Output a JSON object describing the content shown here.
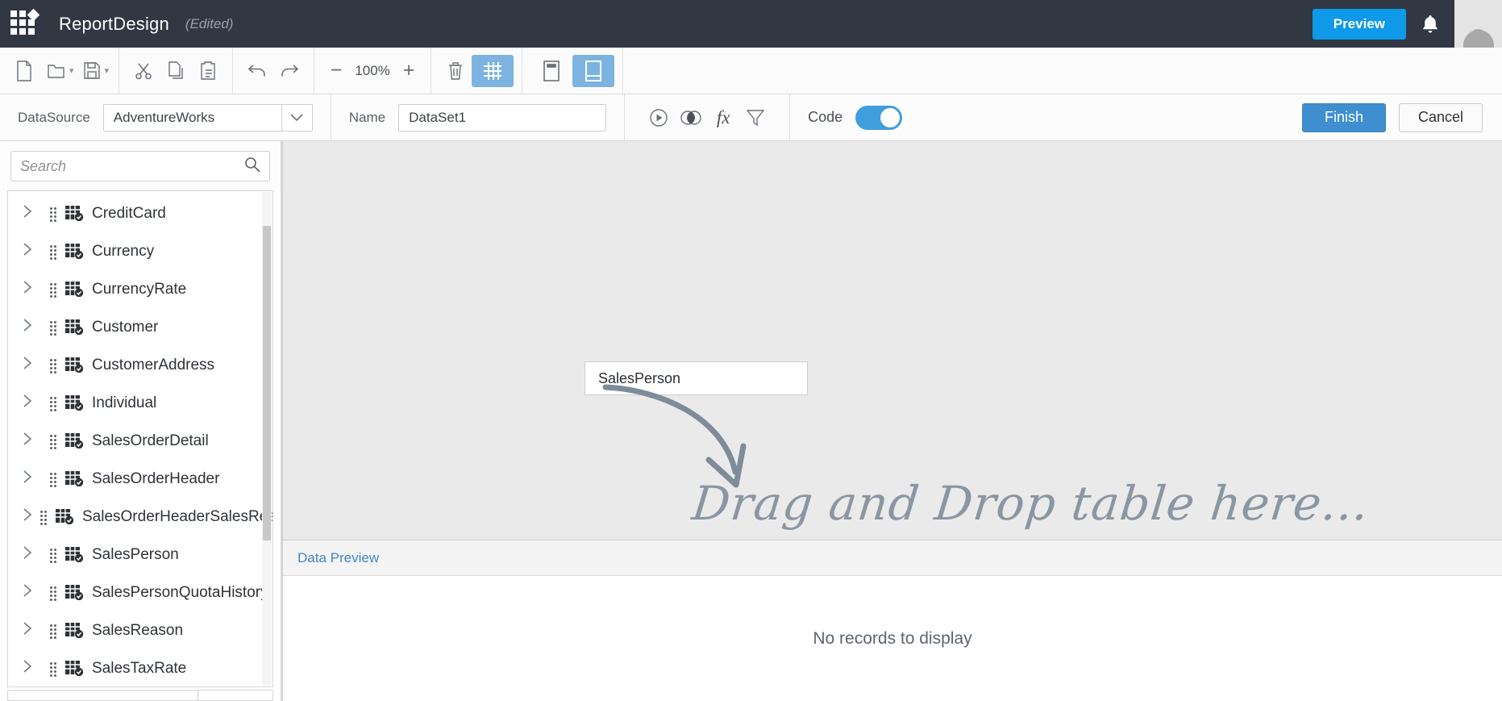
{
  "titlebar": {
    "logo_icon": "grid-diamond-logo",
    "app_title": "ReportDesign",
    "edited_state": "(Edited)",
    "preview_label": "Preview",
    "bell_icon": "notification-bell-icon",
    "avatar_icon": "user-avatar-icon",
    "bg_color": "#323744",
    "preview_color": "#0e9ae8"
  },
  "toolbar": {
    "items": [
      {
        "name": "new-file-icon",
        "label": "New"
      },
      {
        "name": "open-folder-icon",
        "label": "Open"
      },
      {
        "name": "save-icon",
        "label": "Save"
      },
      {
        "name": "cut-icon",
        "label": "Cut"
      },
      {
        "name": "copy-icon",
        "label": "Copy"
      },
      {
        "name": "paste-icon",
        "label": "Paste"
      },
      {
        "name": "undo-icon",
        "label": "Undo"
      },
      {
        "name": "redo-icon",
        "label": "Redo"
      }
    ],
    "zoom_out": "−",
    "zoom_value": "100%",
    "zoom_in": "+",
    "delete_icon": "trash-icon",
    "grid_icon": "grid-toggle-icon",
    "grid_active": true,
    "panel_header_icon": "panel-header-icon",
    "panel_split_icon": "panel-split-icon",
    "panel_split_active": true,
    "active_color": "#7cb3e0"
  },
  "datasetbar": {
    "datasource_label": "DataSource",
    "datasource_value": "AdventureWorks",
    "datasource_caret_icon": "chevron-down-icon",
    "name_label": "Name",
    "name_value": "DataSet1",
    "name_placeholder": "DataSet1",
    "actions": [
      {
        "name": "run-query-icon",
        "label": "Run"
      },
      {
        "name": "join-venn-icon",
        "label": "Join"
      },
      {
        "name": "function-fx-icon",
        "label": "fx"
      },
      {
        "name": "filter-funnel-icon",
        "label": "Filter"
      }
    ],
    "code_label": "Code",
    "code_enabled": true,
    "toggle_color": "#3f9ede",
    "finish_label": "Finish",
    "cancel_label": "Cancel",
    "finish_color": "#3f8fd0"
  },
  "sidebar": {
    "search_placeholder": "Search",
    "search_value": "",
    "search_icon": "search-icon",
    "tree_items": [
      {
        "label": "CreditCard",
        "icon": "table-checked-icon",
        "chevron": "chevron-right-icon"
      },
      {
        "label": "Currency",
        "icon": "table-checked-icon",
        "chevron": "chevron-right-icon"
      },
      {
        "label": "CurrencyRate",
        "icon": "table-checked-icon",
        "chevron": "chevron-right-icon"
      },
      {
        "label": "Customer",
        "icon": "table-checked-icon",
        "chevron": "chevron-right-icon"
      },
      {
        "label": "CustomerAddress",
        "icon": "table-checked-icon",
        "chevron": "chevron-right-icon"
      },
      {
        "label": "Individual",
        "icon": "table-checked-icon",
        "chevron": "chevron-right-icon"
      },
      {
        "label": "SalesOrderDetail",
        "icon": "table-checked-icon",
        "chevron": "chevron-right-icon"
      },
      {
        "label": "SalesOrderHeader",
        "icon": "table-checked-icon",
        "chevron": "chevron-right-icon"
      },
      {
        "label": "SalesOrderHeaderSalesReason",
        "icon": "table-checked-icon",
        "chevron": "chevron-right-icon"
      },
      {
        "label": "SalesPerson",
        "icon": "table-checked-icon",
        "chevron": "chevron-right-icon"
      },
      {
        "label": "SalesPersonQuotaHistory",
        "icon": "table-checked-icon",
        "chevron": "chevron-right-icon"
      },
      {
        "label": "SalesReason",
        "icon": "table-checked-icon",
        "chevron": "chevron-right-icon"
      },
      {
        "label": "SalesTaxRate",
        "icon": "table-checked-icon",
        "chevron": "chevron-right-icon"
      }
    ]
  },
  "canvas": {
    "field_label": "SalesPerson",
    "hint_text": "Drag and Drop table here...",
    "hint_color": "#8a96a3",
    "bg_color": "#eaeaea",
    "arrow_icon": "curved-drop-arrow-icon"
  },
  "preview": {
    "tab_label": "Data Preview",
    "tab_color": "#4187c9",
    "empty_message": "No records to display"
  }
}
